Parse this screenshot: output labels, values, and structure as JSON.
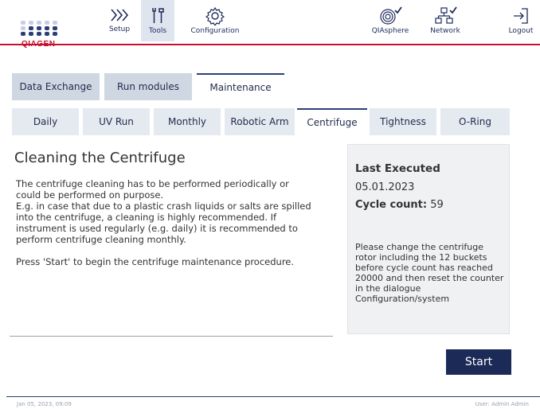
{
  "header": {
    "brand": "QIAGEN",
    "nav_left": [
      {
        "label": "Setup",
        "icon": "chevrons-right-icon"
      },
      {
        "label": "Tools",
        "icon": "tools-icon",
        "active": true
      },
      {
        "label": "Configuration",
        "icon": "gear-icon"
      }
    ],
    "nav_right": [
      {
        "label": "QIAsphere",
        "icon": "qiasphere-icon"
      },
      {
        "label": "Network",
        "icon": "network-icon"
      },
      {
        "label": "Logout",
        "icon": "logout-icon"
      }
    ],
    "accent_color": "#c8102e"
  },
  "top_tabs": [
    {
      "label": "Data Exchange"
    },
    {
      "label": "Run modules"
    },
    {
      "label": "Maintenance",
      "active": true
    }
  ],
  "sub_tabs": [
    {
      "label": "Daily"
    },
    {
      "label": "UV Run"
    },
    {
      "label": "Monthly"
    },
    {
      "label": "Robotic Arm"
    },
    {
      "label": "Centrifuge",
      "active": true
    },
    {
      "label": "Tightness"
    },
    {
      "label": "O-Ring"
    }
  ],
  "content": {
    "title": "Cleaning the Centrifuge",
    "lines": [
      "The centrifuge cleaning has to be performed periodically or",
      "could be performed on purpose.",
      "E.g. in case that due to a plastic crash liquids or salts are spilled",
      "into the centrifuge, a cleaning is highly recommended. If",
      "instrument is used regularly (e.g. daily) it is recommended to",
      "perform centrifuge cleaning monthly."
    ],
    "instruction": "Press 'Start' to begin the centrifuge maintenance procedure."
  },
  "info": {
    "last_executed_label": "Last Executed",
    "last_executed_date": "05.01.2023",
    "cycle_count_label": "Cycle count:",
    "cycle_count_value": "59",
    "note": "Please change the centrifuge rotor including the 12 buckets before cycle count has reached 20000 and then reset the counter in the dialogue Configuration/system"
  },
  "actions": {
    "start_label": "Start",
    "start_color": "#1b2a57"
  },
  "footer": {
    "datetime": "Jan 05, 2023,  09:09",
    "user": "User: Admin Admin"
  }
}
